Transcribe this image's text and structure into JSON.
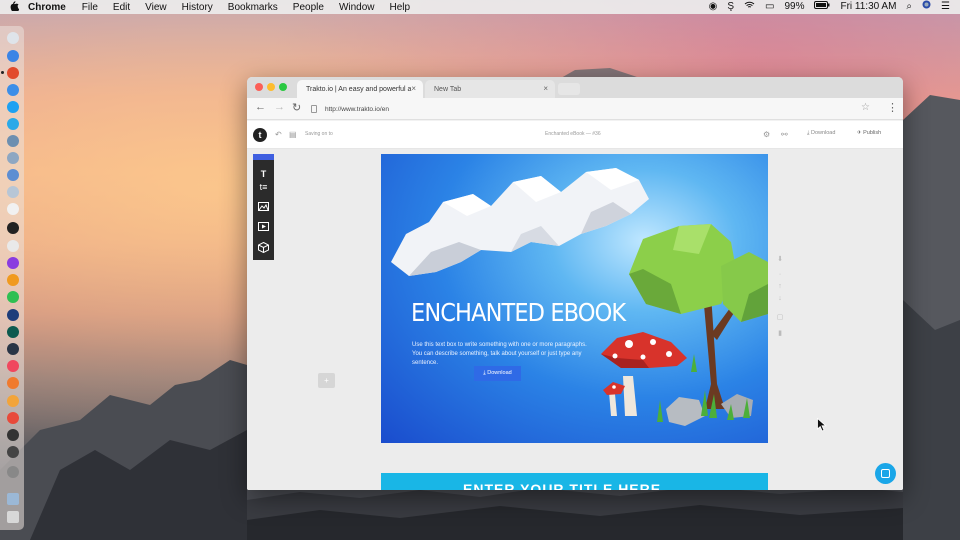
{
  "menubar": {
    "apple": "",
    "app_name": "Chrome",
    "menus": [
      "File",
      "Edit",
      "View",
      "History",
      "Bookmarks",
      "People",
      "Window",
      "Help"
    ],
    "battery": "99%",
    "clock": "Fri 11:30 AM"
  },
  "browser": {
    "tabs": [
      {
        "title": "Trakto.io | An easy and powerful a",
        "close": "×"
      },
      {
        "title": "New Tab",
        "close": "×"
      }
    ],
    "url": "http://www.trakto.io/en"
  },
  "editor": {
    "logo": "t",
    "saving": "Saving on to",
    "doc_title": "Enchanted eBook — #36",
    "download_label": "Download",
    "publish_label": "Publish"
  },
  "page": {
    "title": "ENCHANTED EBOOK",
    "body": "Use this text box to write something with one or more paragraphs. You can describe something, talk about yourself or just type any sentence.",
    "download_label": "Download",
    "add_page": "+"
  },
  "page2": {
    "title": "ENTER YOUR TITLE HERE"
  },
  "colors": {
    "accent": "#3f5fe0",
    "chat": "#1aa6e8",
    "page2": "#19b6e6"
  }
}
